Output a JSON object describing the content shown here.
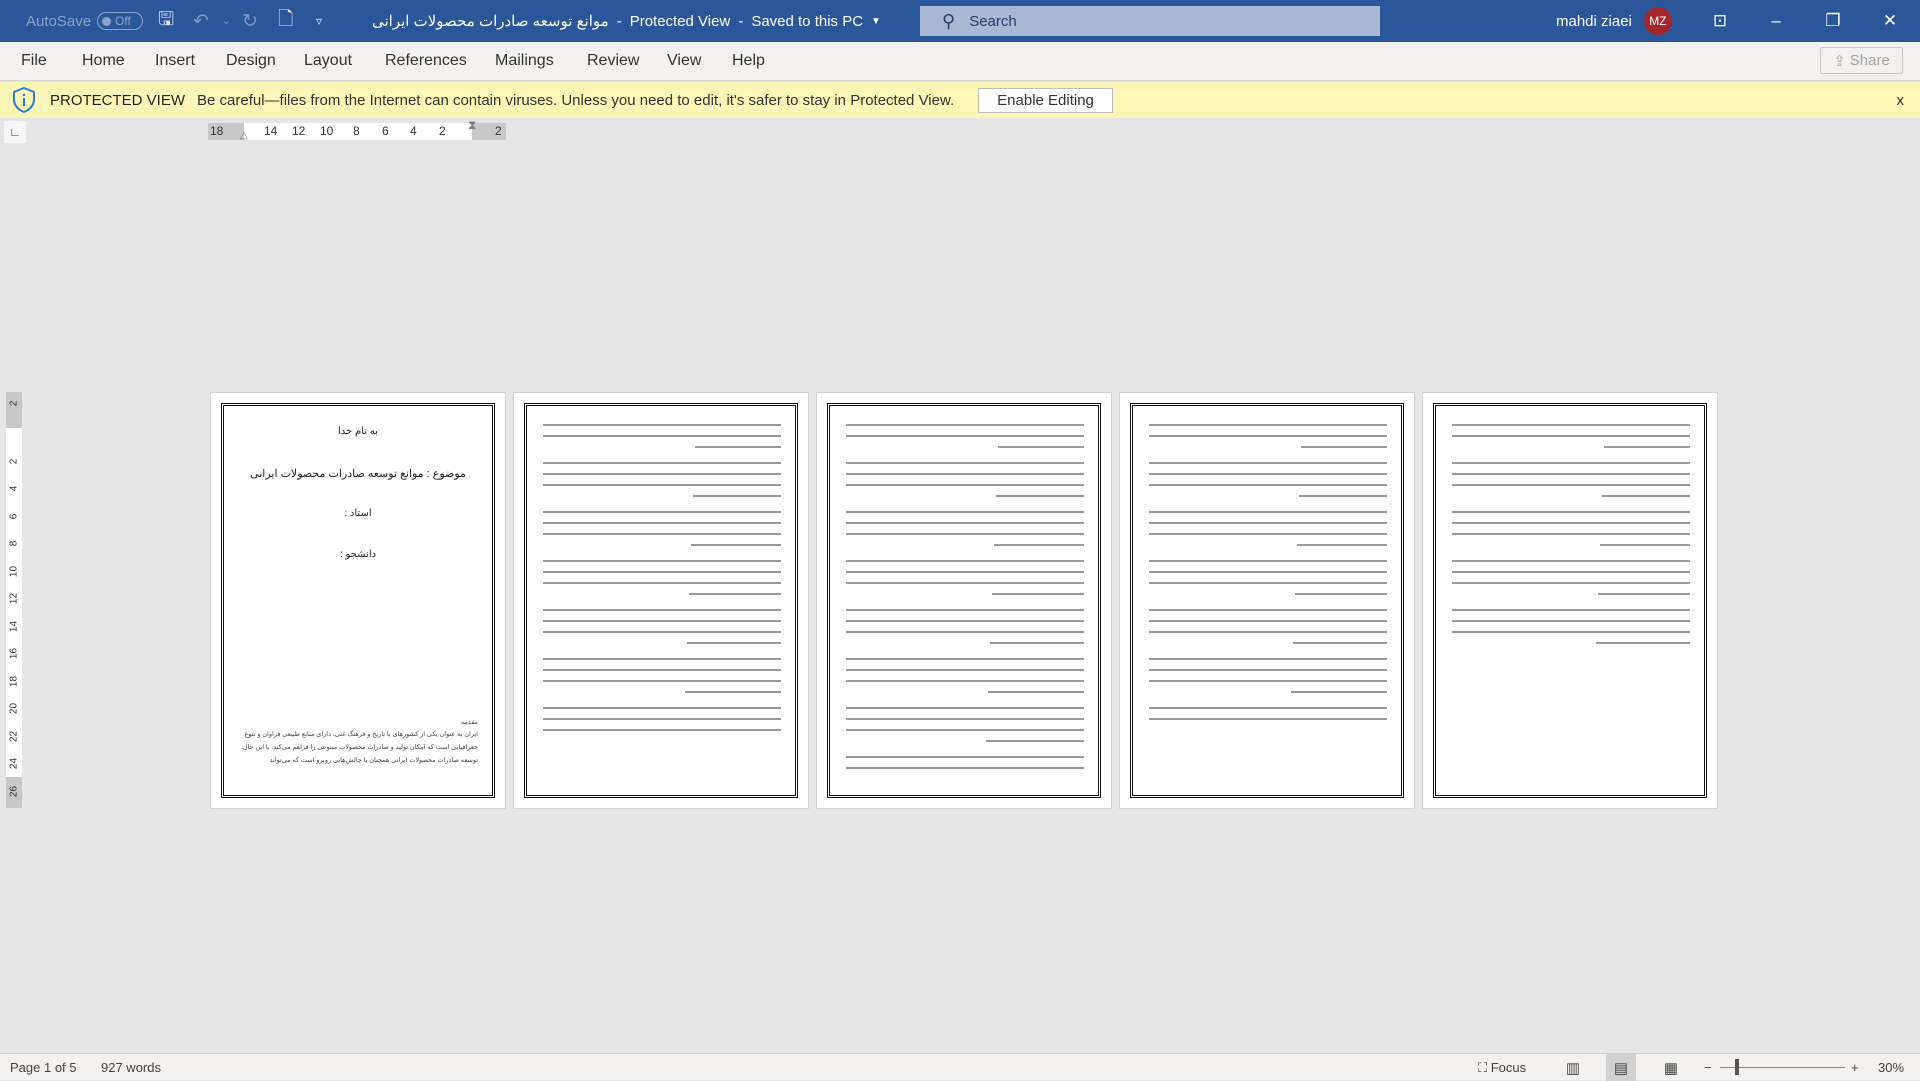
{
  "titlebar": {
    "autosave_label": "AutoSave",
    "autosave_state": "Off",
    "doc_title": "موانع توسعه صادرات محصولات ایرانی",
    "mode": "Protected View",
    "save_state": "Saved to this PC",
    "search_placeholder": "Search",
    "user_name": "mahdi ziaei",
    "user_initials": "MZ",
    "avatar_color": "#a4262c",
    "brand_color": "#2b579a"
  },
  "ribbon": {
    "tabs": [
      "File",
      "Home",
      "Insert",
      "Design",
      "Layout",
      "References",
      "Mailings",
      "Review",
      "View",
      "Help"
    ],
    "share_label": "Share"
  },
  "protected_view": {
    "title": "PROTECTED VIEW",
    "message": "Be careful—files from the Internet can contain viruses. Unless you need to edit, it's safer to stay in Protected View.",
    "button": "Enable Editing",
    "close": "x"
  },
  "ruler": {
    "horizontal": [
      "18",
      "14",
      "12",
      "10",
      "8",
      "6",
      "4",
      "2",
      "2"
    ],
    "vertical": [
      "2",
      "2",
      "4",
      "6",
      "8",
      "10",
      "12",
      "14",
      "16",
      "18",
      "20",
      "22",
      "24",
      "26"
    ]
  },
  "document": {
    "cover": {
      "line1": "به نام خدا",
      "line2": "موضوع : موانع توسعه صادرات محصولات ایرانی",
      "line3": "استاد :",
      "line4": "دانشجو :",
      "intro_heading": "مقدمه",
      "intro_text": "ایران به عنوان یکی از کشورهای با تاریخ و فرهنگ غنی، دارای منابع طبیعی فراوان و تنوع جغرافیایی است که امکان تولید و صادرات محصولات متنوعی را فراهم می‌کند. با این حال، توسعه صادرات محصولات ایرانی همچنان با چالش‌هایی روبرو است که می‌تواند"
    }
  },
  "statusbar": {
    "page": "Page 1 of 5",
    "words": "927 words",
    "focus": "Focus",
    "zoom": "30%",
    "zoom_percent": 30
  }
}
